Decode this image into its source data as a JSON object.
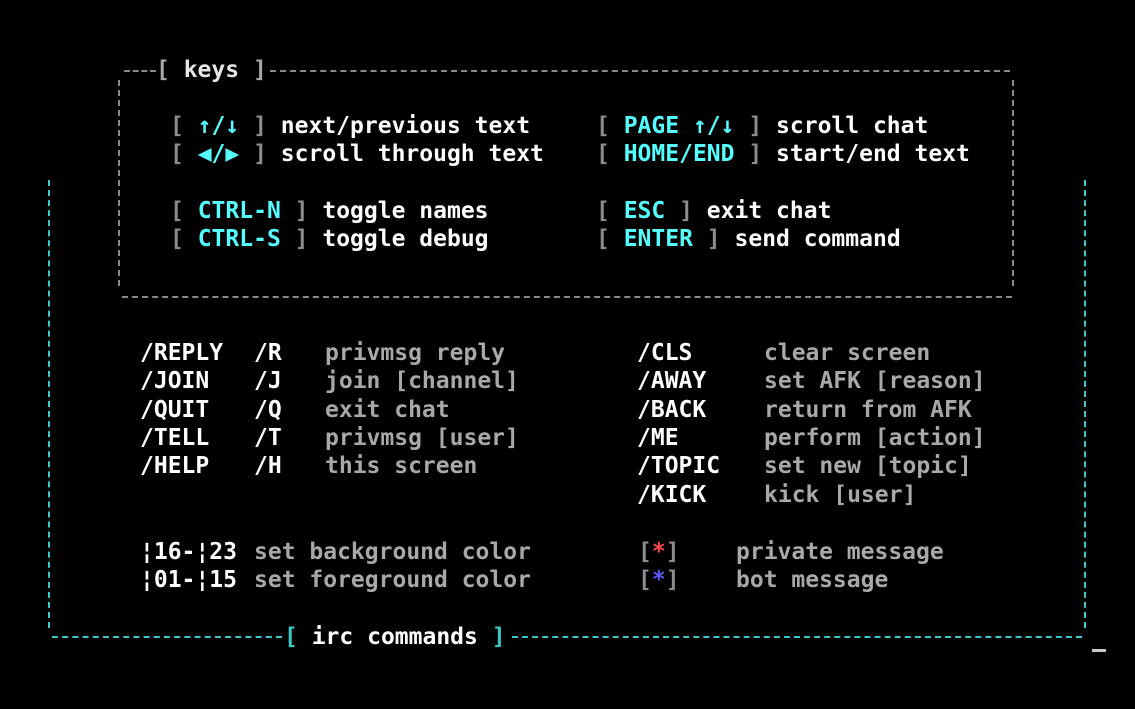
{
  "keys_box": {
    "title": "keys",
    "bindings": [
      {
        "key": "↑/↓",
        "desc": "next/previous text"
      },
      {
        "key": "◀/▶",
        "desc": "scroll through text"
      },
      {
        "key": "CTRL-N",
        "desc": "toggle names"
      },
      {
        "key": "CTRL-S",
        "desc": "toggle debug"
      },
      {
        "key": "PAGE ↑/↓",
        "desc": "scroll chat"
      },
      {
        "key": "HOME/END",
        "desc": "start/end text"
      },
      {
        "key": "ESC",
        "desc": "exit chat"
      },
      {
        "key": "ENTER",
        "desc": "send command"
      }
    ]
  },
  "irc_box": {
    "title": "irc commands",
    "commands_left": [
      {
        "cmd": "/REPLY",
        "alias": "/R",
        "desc": "privmsg reply"
      },
      {
        "cmd": "/JOIN",
        "alias": "/J",
        "desc": "join [channel]"
      },
      {
        "cmd": "/QUIT",
        "alias": "/Q",
        "desc": "exit chat"
      },
      {
        "cmd": "/TELL",
        "alias": "/T",
        "desc": "privmsg [user]"
      },
      {
        "cmd": "/HELP",
        "alias": "/H",
        "desc": "this screen"
      }
    ],
    "commands_right": [
      {
        "cmd": "/CLS",
        "desc": "clear screen"
      },
      {
        "cmd": "/AWAY",
        "desc": "set AFK [reason]"
      },
      {
        "cmd": "/BACK",
        "desc": "return from AFK"
      },
      {
        "cmd": "/ME",
        "desc": "perform [action]"
      },
      {
        "cmd": "/TOPIC",
        "desc": "set new [topic]"
      },
      {
        "cmd": "/KICK",
        "desc": "kick [user]"
      }
    ],
    "colors": [
      {
        "code": "¦16-¦23",
        "desc": "set background color"
      },
      {
        "code": "¦01-¦15",
        "desc": "set foreground color"
      }
    ],
    "legend": [
      {
        "mark": "*",
        "desc": "private message",
        "color": "#ff4b4b"
      },
      {
        "mark": "*",
        "desc": "bot message",
        "color": "#5a5aff"
      }
    ]
  }
}
